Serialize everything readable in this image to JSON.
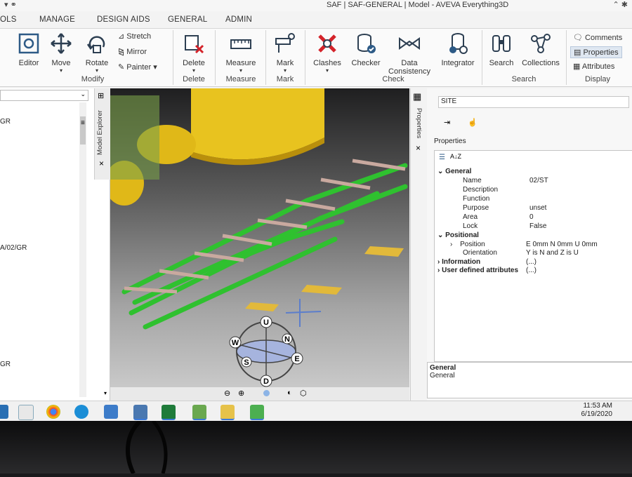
{
  "window": {
    "title": "SAF | SAF-GENERAL | Model - AVEVA Everything3D"
  },
  "tabs": [
    "OLS",
    "MANAGE",
    "DESIGN AIDS",
    "GENERAL",
    "ADMIN"
  ],
  "ribbon": {
    "modify": {
      "group_label": "Modify",
      "editor": "Editor",
      "move": "Move",
      "rotate": "Rotate",
      "stretch": "Stretch",
      "mirror": "Mirror",
      "painter": "Painter"
    },
    "delete": {
      "group_label": "Delete",
      "button": "Delete"
    },
    "measure": {
      "group_label": "Measure",
      "button": "Measure"
    },
    "mark": {
      "group_label": "Mark",
      "button": "Mark"
    },
    "check": {
      "group_label": "Check",
      "clashes": "Clashes",
      "checker": "Checker",
      "data_consistency_1": "Data",
      "data_consistency_2": "Consistency",
      "integrator": "Integrator"
    },
    "search": {
      "group_label": "Search",
      "search": "Search",
      "collections": "Collections"
    },
    "display": {
      "group_label": "Display",
      "comments": "Comments",
      "properties": "Properties",
      "attributes": "Attributes"
    }
  },
  "model_explorer": {
    "title": "Model Explorer",
    "items": [
      "GR",
      "A/02/GR",
      "GR"
    ]
  },
  "viewport": {
    "compass": {
      "up": "U",
      "down": "D",
      "north": "N",
      "south": "S",
      "east": "E",
      "west": "W"
    }
  },
  "properties": {
    "strip_title": "Properties",
    "element_field": "SITE",
    "panel_title": "Properties",
    "sort_az": "A↓Z",
    "sections": {
      "general": "General",
      "positional": "Positional",
      "information": "Information",
      "information_value": "(...)",
      "user_defined": "User defined attributes",
      "user_defined_value": "(...)"
    },
    "general_rows": [
      {
        "name": "Name",
        "value": "02/ST"
      },
      {
        "name": "Description",
        "value": ""
      },
      {
        "name": "Function",
        "value": ""
      },
      {
        "name": "Purpose",
        "value": "unset"
      },
      {
        "name": "Area",
        "value": "0"
      },
      {
        "name": "Lock",
        "value": "False"
      }
    ],
    "positional_rows": [
      {
        "name": "Position",
        "value": "E 0mm N 0mm U 0mm"
      },
      {
        "name": "Orientation",
        "value": "Y is N and Z is U"
      }
    ],
    "description_box": {
      "title": "General",
      "text": "General"
    }
  },
  "taskbar": {
    "time": "11:53 AM",
    "date": "6/19/2020"
  }
}
